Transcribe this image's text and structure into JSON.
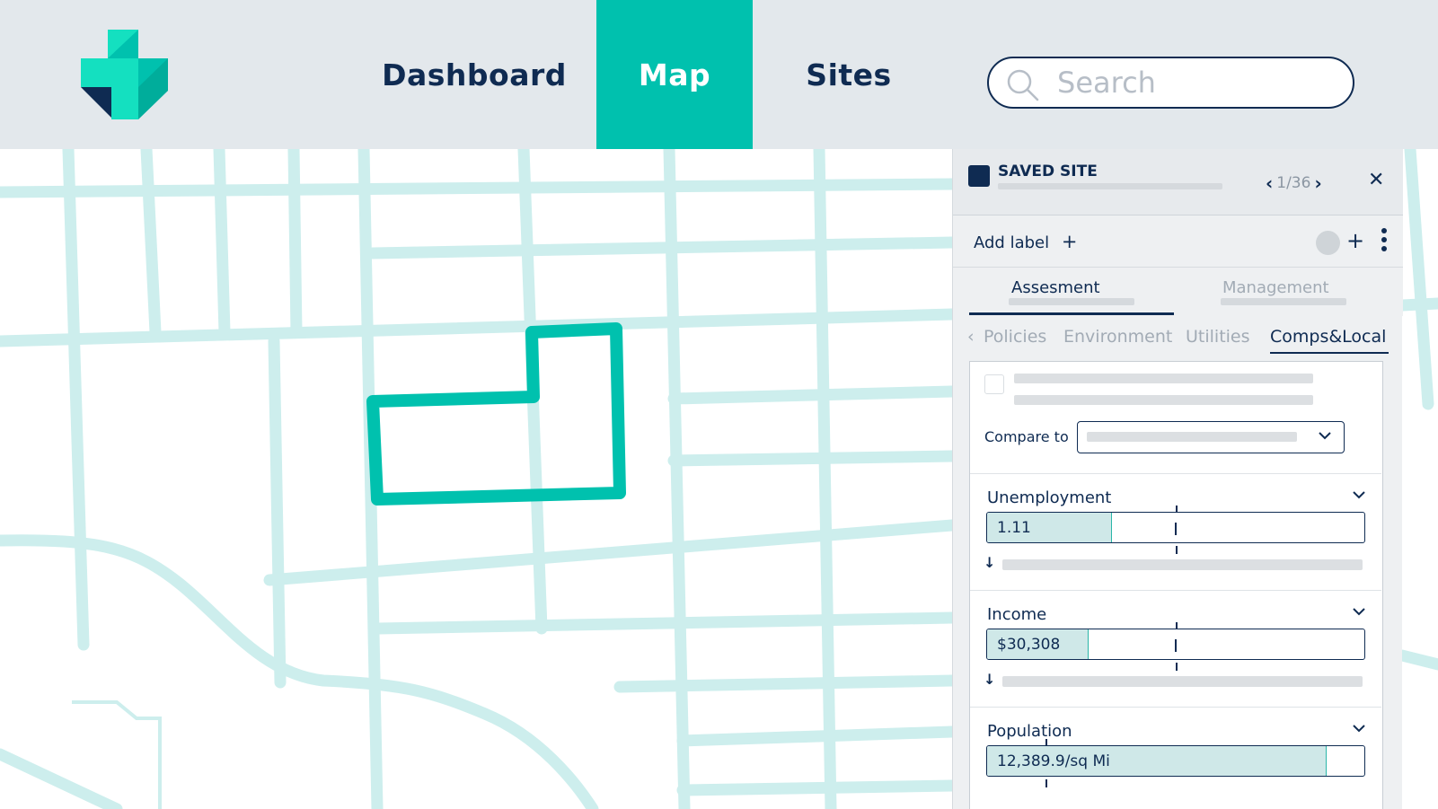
{
  "nav": {
    "items": [
      {
        "label": "Dashboard",
        "active": false
      },
      {
        "label": "Map",
        "active": true
      },
      {
        "label": "Sites",
        "active": false
      }
    ],
    "search_placeholder": "Search"
  },
  "colors": {
    "header_bg": "#e3e8ec",
    "accent": "#00c1ae",
    "navy": "#0f2b52",
    "map_streets": "#cdeeed"
  },
  "panel": {
    "saved_title": "SAVED SITE",
    "pager_text": "1/36",
    "add_label": "Add label",
    "tabs": [
      {
        "label": "Assesment",
        "active": true
      },
      {
        "label": "Management",
        "active": false
      }
    ],
    "subtabs": [
      {
        "label": "Policies",
        "active": false
      },
      {
        "label": "Environment",
        "active": false
      },
      {
        "label": "Utilities",
        "active": false
      },
      {
        "label": "Comps&Local",
        "active": true
      }
    ],
    "compare_label": "Compare to",
    "metrics": [
      {
        "title": "Unemployment",
        "value": "1.11",
        "fill_fraction": 0.33
      },
      {
        "title": "Income",
        "value": "$30,308",
        "fill_fraction": 0.27
      },
      {
        "title": "Population",
        "value": "12,389.9/sq Mi",
        "fill_fraction": 0.9
      }
    ]
  }
}
